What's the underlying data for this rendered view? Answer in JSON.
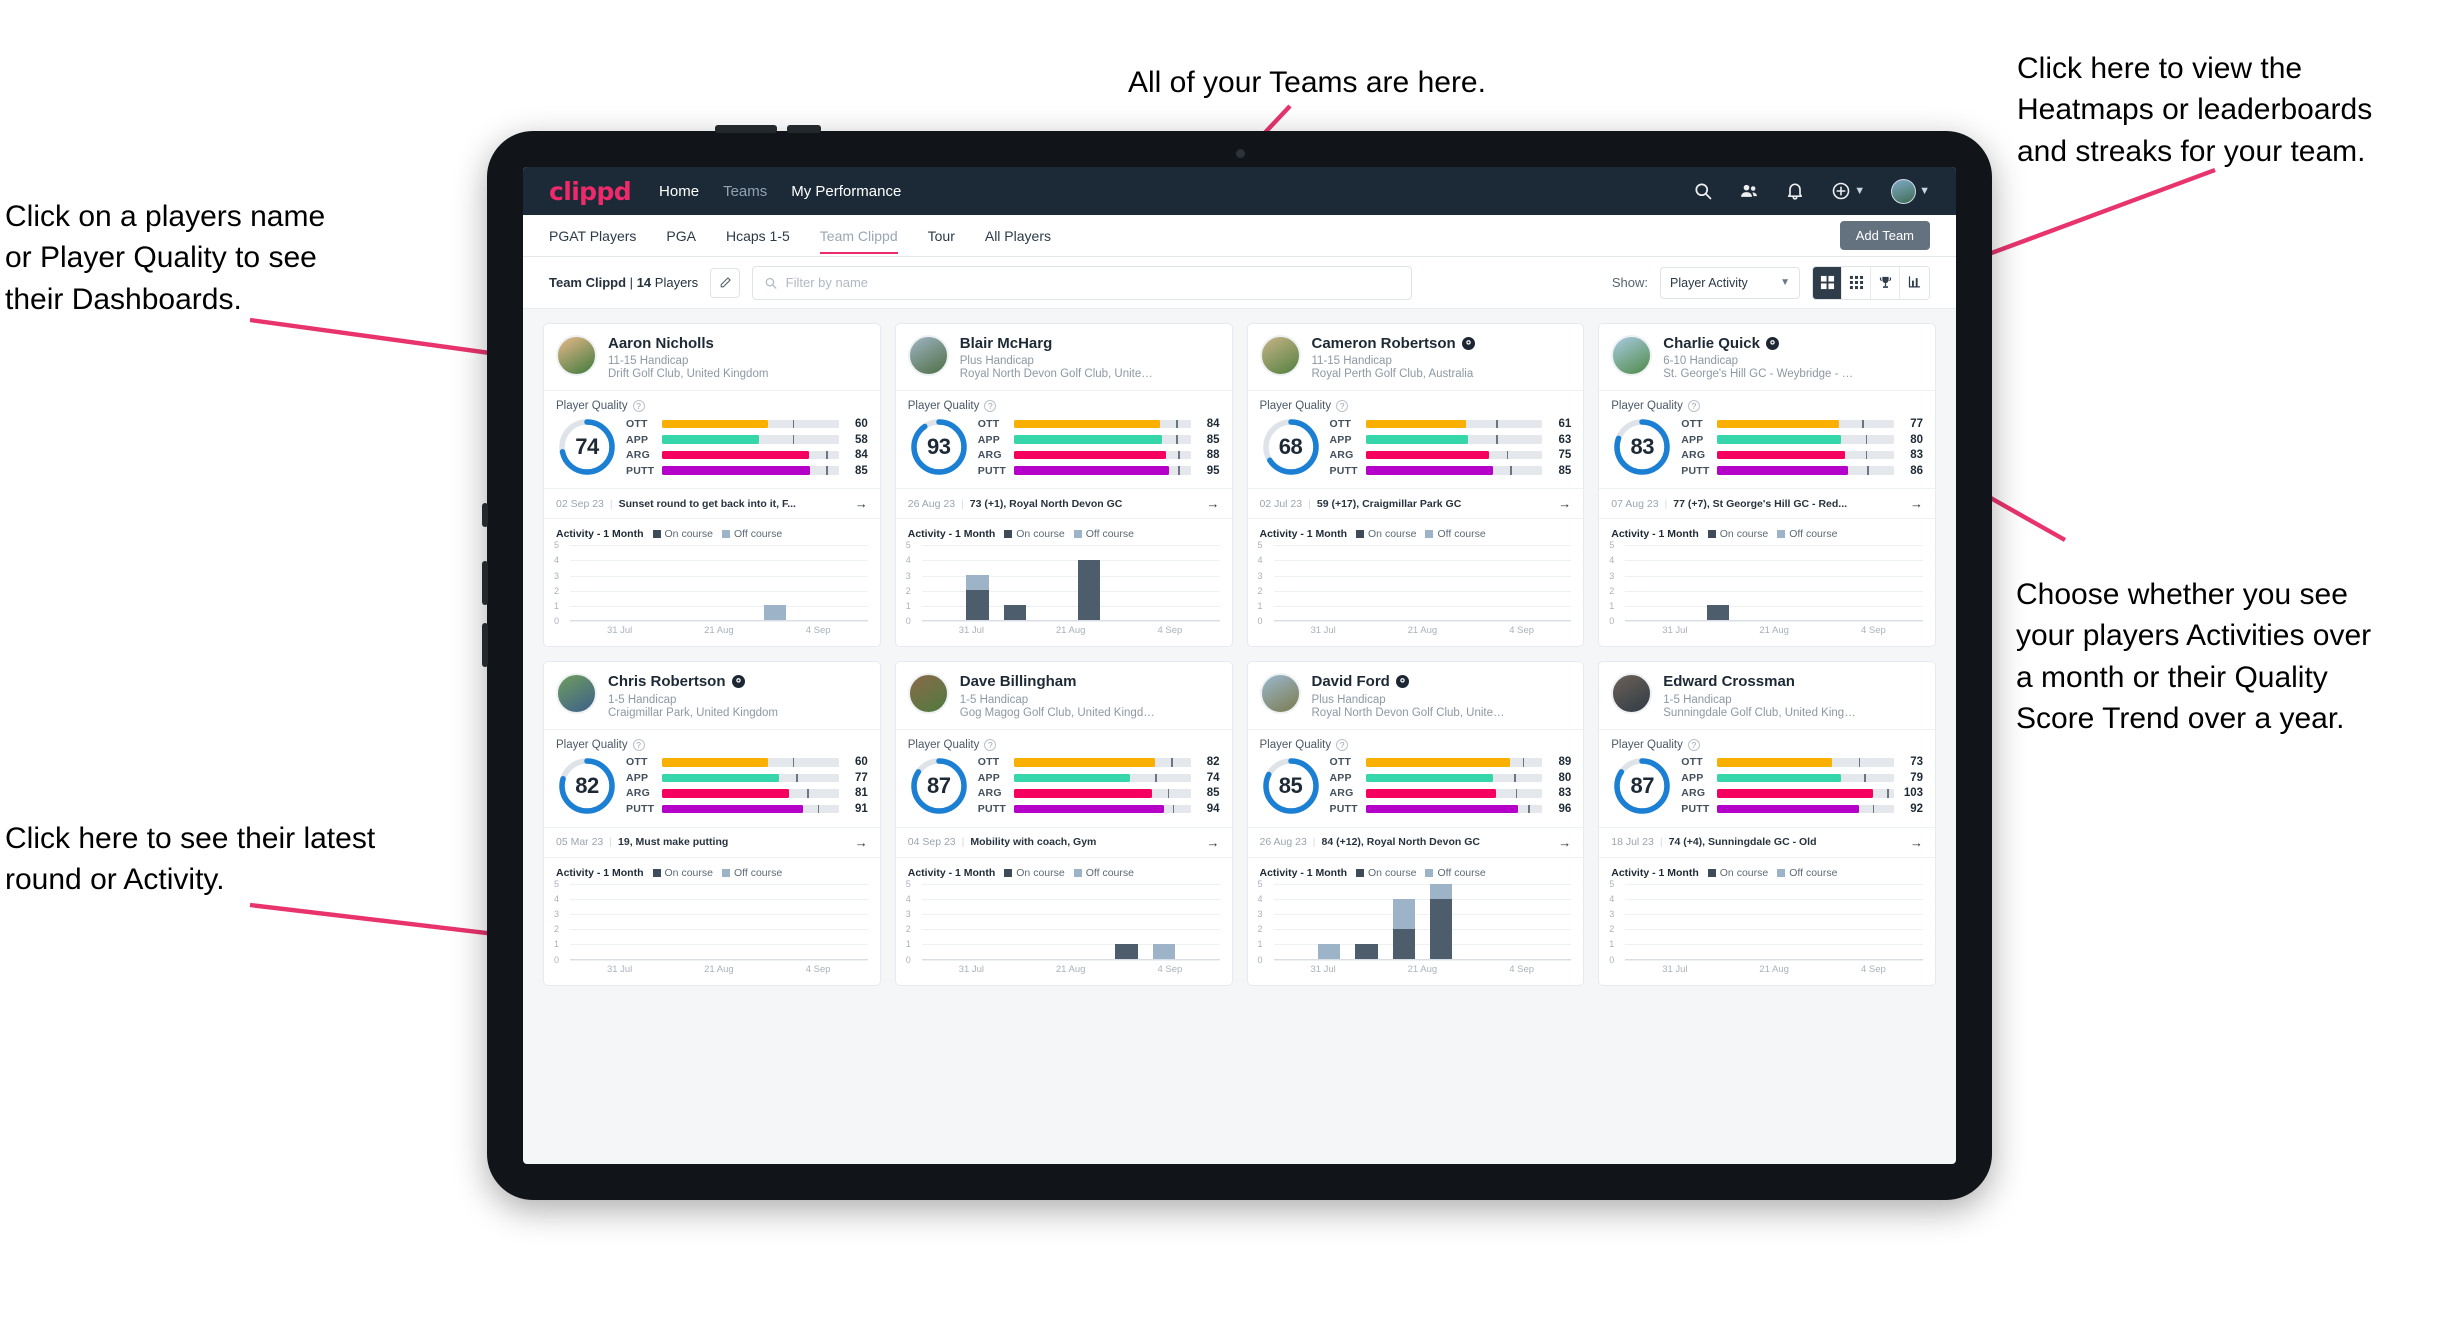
{
  "annotations": [
    {
      "key": "teams",
      "text": "All of your Teams are here."
    },
    {
      "key": "heat",
      "text": "Click here to view the\nHeatmaps or leaderboards\nand streaks for your team."
    },
    {
      "key": "names",
      "text": "Click on a players name\nor Player Quality to see\ntheir Dashboards."
    },
    {
      "key": "choose",
      "text": "Choose whether you see\nyour players Activities over\na month or their Quality\nScore Trend over a year."
    },
    {
      "key": "latest",
      "text": "Click here to see their latest\nround or Activity."
    }
  ],
  "topnav": {
    "logo": "clippd",
    "links": [
      {
        "label": "Home",
        "active": true
      },
      {
        "label": "Teams",
        "active": false
      },
      {
        "label": "My Performance",
        "active": true
      }
    ],
    "icons": [
      "search-icon",
      "people-icon",
      "bell-icon",
      "plus-circle-icon",
      "avatar"
    ]
  },
  "tabs": [
    {
      "label": "PGAT Players",
      "active": false
    },
    {
      "label": "PGA",
      "active": false
    },
    {
      "label": "Hcaps 1-5",
      "active": false
    },
    {
      "label": "Team Clippd",
      "active": true
    },
    {
      "label": "Tour",
      "active": false
    },
    {
      "label": "All Players",
      "active": false
    }
  ],
  "add_team_label": "Add Team",
  "filterbar": {
    "team_name": "Team Clippd",
    "player_count": "14",
    "players_word": "Players",
    "separator": "|",
    "edit_icon": "pencil-icon",
    "search_placeholder": "Filter by name",
    "search_value": "",
    "show_label": "Show:",
    "show_value": "Player Activity",
    "show_options": [
      "Player Activity",
      "Quality Score Trend"
    ],
    "views": [
      {
        "name": "grid-large-view",
        "active": true
      },
      {
        "name": "grid-small-view",
        "active": false
      },
      {
        "name": "trophy-leaderboard-view",
        "active": false
      },
      {
        "name": "heatmap-view",
        "active": false
      }
    ]
  },
  "card_labels": {
    "player_quality": "Player Quality",
    "activity_title": "Activity - 1 Month",
    "legend_on": "On course",
    "legend_off": "Off course",
    "help_icon": "question-mark-icon",
    "arrow_icon": "arrow-right-icon"
  },
  "metric_colors": {
    "OTT": "#f9b000",
    "APP": "#35d6a9",
    "ARG": "#f5005e",
    "PUTT": "#b400c8",
    "ring": "#1b7fd4",
    "ring_track": "#dde3e9",
    "on_course": "#4e5d6c",
    "off_course": "#9db3c7"
  },
  "chart_data": {
    "type": "bar",
    "title": "Activity - 1 Month",
    "ylabel": "",
    "xlabel": "",
    "ylim": [
      0,
      5
    ],
    "yticks": [
      0,
      1,
      2,
      3,
      4,
      5
    ],
    "categories": [
      "31 Jul",
      "",
      "21 Aug",
      "4 Sep"
    ],
    "xtick_labels": [
      "31 Jul",
      "21 Aug",
      "4 Sep"
    ],
    "legend": [
      "On course",
      "Off course"
    ],
    "legend_position": "top",
    "grid": true,
    "panels": [
      {
        "player": "Aaron Nicholls",
        "slots": 8,
        "bars": [
          {
            "i": 5,
            "on": 0,
            "off": 1
          }
        ]
      },
      {
        "player": "Blair McHarg",
        "slots": 8,
        "bars": [
          {
            "i": 1,
            "on": 2,
            "off": 1
          },
          {
            "i": 2,
            "on": 1,
            "off": 0
          },
          {
            "i": 4,
            "on": 4,
            "off": 0
          }
        ]
      },
      {
        "player": "Cameron Robertson",
        "slots": 8,
        "bars": []
      },
      {
        "player": "Charlie Quick",
        "slots": 8,
        "bars": [
          {
            "i": 2,
            "on": 1,
            "off": 0
          }
        ]
      },
      {
        "player": "Chris Robertson",
        "slots": 8,
        "bars": []
      },
      {
        "player": "Dave Billingham",
        "slots": 8,
        "bars": [
          {
            "i": 5,
            "on": 1,
            "off": 0
          },
          {
            "i": 6,
            "on": 0,
            "off": 1
          }
        ]
      },
      {
        "player": "David Ford",
        "slots": 8,
        "bars": [
          {
            "i": 1,
            "on": 0,
            "off": 1
          },
          {
            "i": 2,
            "on": 1,
            "off": 0
          },
          {
            "i": 3,
            "on": 2,
            "off": 2
          },
          {
            "i": 4,
            "on": 4,
            "off": 1
          }
        ]
      },
      {
        "player": "Edward Crossman",
        "slots": 8,
        "bars": []
      }
    ]
  },
  "players": [
    {
      "name": "Aaron Nicholls",
      "verified": false,
      "handicap": "11-15 Handicap",
      "club": "Drift Golf Club, United Kingdom",
      "quality": 74,
      "metrics": [
        {
          "key": "OTT",
          "value": 60,
          "fill": 60,
          "tick": 74
        },
        {
          "key": "APP",
          "value": 58,
          "fill": 55,
          "tick": 74
        },
        {
          "key": "ARG",
          "value": 84,
          "fill": 83,
          "tick": 93
        },
        {
          "key": "PUTT",
          "value": 85,
          "fill": 84,
          "tick": 93
        }
      ],
      "round_date": "02 Sep 23",
      "round_text": "Sunset round to get back into it, F...",
      "avatar_from": "#e8b88a",
      "avatar_to": "#3e7a3c"
    },
    {
      "name": "Blair McHarg",
      "verified": false,
      "handicap": "Plus Handicap",
      "club": "Royal North Devon Golf Club, United Kin...",
      "quality": 93,
      "metrics": [
        {
          "key": "OTT",
          "value": 84,
          "fill": 83,
          "tick": 92
        },
        {
          "key": "APP",
          "value": 85,
          "fill": 84,
          "tick": 92
        },
        {
          "key": "ARG",
          "value": 88,
          "fill": 86,
          "tick": 93
        },
        {
          "key": "PUTT",
          "value": 95,
          "fill": 88,
          "tick": 93
        }
      ],
      "round_date": "26 Aug 23",
      "round_text": "73 (+1), Royal North Devon GC",
      "avatar_from": "#9fb4c4",
      "avatar_to": "#4e6e44"
    },
    {
      "name": "Cameron Robertson",
      "verified": true,
      "handicap": "11-15 Handicap",
      "club": "Royal Perth Golf Club, Australia",
      "quality": 68,
      "metrics": [
        {
          "key": "OTT",
          "value": 61,
          "fill": 57,
          "tick": 74
        },
        {
          "key": "APP",
          "value": 63,
          "fill": 58,
          "tick": 74
        },
        {
          "key": "ARG",
          "value": 75,
          "fill": 70,
          "tick": 80
        },
        {
          "key": "PUTT",
          "value": 85,
          "fill": 72,
          "tick": 82
        }
      ],
      "round_date": "02 Jul 23",
      "round_text": "59 (+17), Craigmillar Park GC",
      "avatar_from": "#c7b487",
      "avatar_to": "#53803f"
    },
    {
      "name": "Charlie Quick",
      "verified": true,
      "handicap": "6-10 Handicap",
      "club": "St. George's Hill GC - Weybridge - Surrey, ...",
      "quality": 83,
      "metrics": [
        {
          "key": "OTT",
          "value": 77,
          "fill": 69,
          "tick": 82
        },
        {
          "key": "APP",
          "value": 80,
          "fill": 70,
          "tick": 84
        },
        {
          "key": "ARG",
          "value": 83,
          "fill": 72,
          "tick": 84
        },
        {
          "key": "PUTT",
          "value": 86,
          "fill": 74,
          "tick": 85
        }
      ],
      "round_date": "07 Aug 23",
      "round_text": "77 (+7), St George's Hill GC - Red...",
      "avatar_from": "#a9cbe3",
      "avatar_to": "#4e8a46"
    },
    {
      "name": "Chris Robertson",
      "verified": true,
      "handicap": "1-5 Handicap",
      "club": "Craigmillar Park, United Kingdom",
      "quality": 82,
      "metrics": [
        {
          "key": "OTT",
          "value": 60,
          "fill": 60,
          "tick": 74
        },
        {
          "key": "APP",
          "value": 77,
          "fill": 66,
          "tick": 76
        },
        {
          "key": "ARG",
          "value": 81,
          "fill": 72,
          "tick": 82
        },
        {
          "key": "PUTT",
          "value": 91,
          "fill": 80,
          "tick": 88
        }
      ],
      "round_date": "05 Mar 23",
      "round_text": "19, Must make putting",
      "avatar_from": "#6f9d5e",
      "avatar_to": "#3d5f8a"
    },
    {
      "name": "Dave Billingham",
      "verified": false,
      "handicap": "1-5 Handicap",
      "club": "Gog Magog Golf Club, United Kingdom",
      "quality": 87,
      "metrics": [
        {
          "key": "OTT",
          "value": 82,
          "fill": 80,
          "tick": 89
        },
        {
          "key": "APP",
          "value": 74,
          "fill": 66,
          "tick": 80
        },
        {
          "key": "ARG",
          "value": 85,
          "fill": 78,
          "tick": 87
        },
        {
          "key": "PUTT",
          "value": 94,
          "fill": 85,
          "tick": 90
        }
      ],
      "round_date": "04 Sep 23",
      "round_text": "Mobility with coach, Gym",
      "avatar_from": "#8a6a4a",
      "avatar_to": "#4f7a3f"
    },
    {
      "name": "David Ford",
      "verified": true,
      "handicap": "Plus Handicap",
      "club": "Royal North Devon Golf Club, United Kin...",
      "quality": 85,
      "metrics": [
        {
          "key": "OTT",
          "value": 89,
          "fill": 82,
          "tick": 89
        },
        {
          "key": "APP",
          "value": 80,
          "fill": 72,
          "tick": 84
        },
        {
          "key": "ARG",
          "value": 83,
          "fill": 74,
          "tick": 85
        },
        {
          "key": "PUTT",
          "value": 96,
          "fill": 86,
          "tick": 92
        }
      ],
      "round_date": "26 Aug 23",
      "round_text": "84 (+12), Royal North Devon GC",
      "avatar_from": "#9bb9cf",
      "avatar_to": "#7b7a4e"
    },
    {
      "name": "Edward Crossman",
      "verified": false,
      "handicap": "1-5 Handicap",
      "club": "Sunningdale Golf Club, United Kingdom",
      "quality": 87,
      "metrics": [
        {
          "key": "OTT",
          "value": 73,
          "fill": 65,
          "tick": 80
        },
        {
          "key": "APP",
          "value": 79,
          "fill": 70,
          "tick": 83
        },
        {
          "key": "ARG",
          "value": 103,
          "fill": 88,
          "tick": 96
        },
        {
          "key": "PUTT",
          "value": 92,
          "fill": 80,
          "tick": 88
        }
      ],
      "round_date": "18 Jul 23",
      "round_text": "74 (+4), Sunningdale GC - Old",
      "avatar_from": "#6d6157",
      "avatar_to": "#2f3b46"
    }
  ]
}
